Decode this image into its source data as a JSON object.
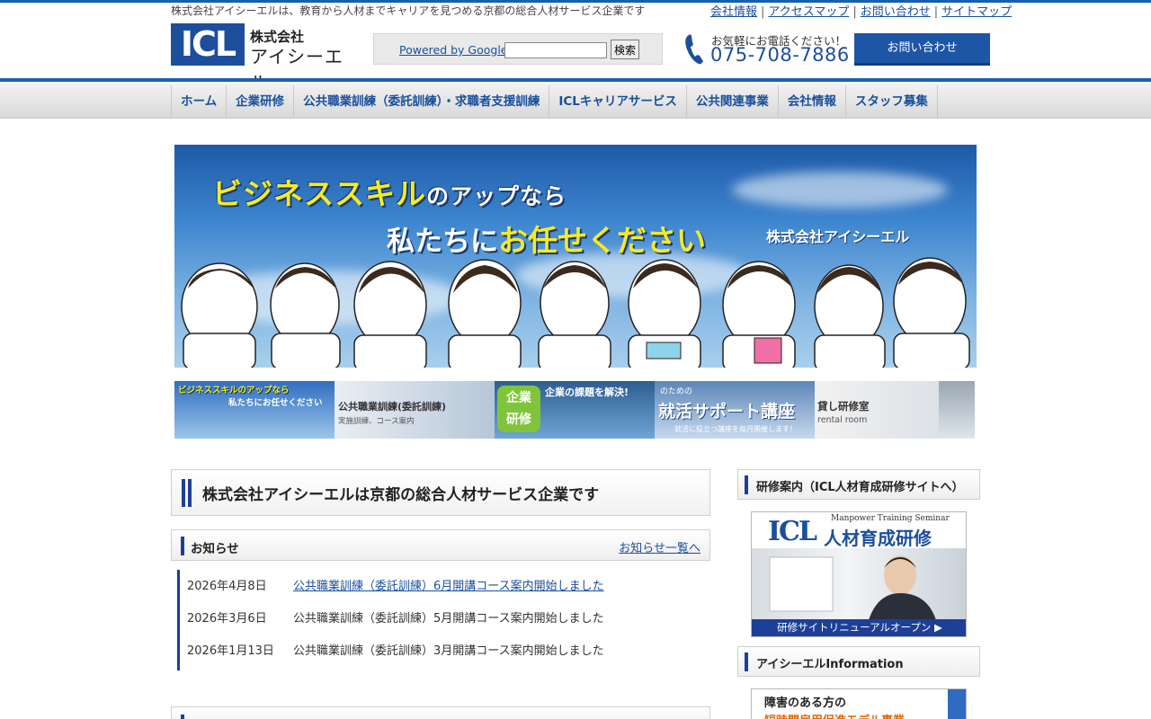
{
  "header": {
    "tagline": "株式会社アイシーエルは、教育から人材までキャリアを見つめる京都の総合人材サービス企業です",
    "top_links": [
      "会社情報",
      "アクセスマップ",
      "お問い合わせ",
      "サイトマップ"
    ],
    "logo": {
      "mark": "ICL",
      "line1": "株式会社",
      "line2": "アイシーエル"
    },
    "search": {
      "powered_by": "Powered by Google",
      "value": "",
      "button": "検索"
    },
    "phone": {
      "label": "お気軽にお電話ください！",
      "number": "075-708-7886"
    },
    "contact_button": "お問い合わせ"
  },
  "nav": [
    "ホーム",
    "企業研修",
    "公共職業訓練（委託訓練）・求職者支援訓練",
    "ICLキャリアサービス",
    "公共関連事業",
    "会社情報",
    "スタッフ募集"
  ],
  "hero": {
    "line1_a": "ビジネススキル",
    "line1_b": "のアップなら",
    "line2_a": "私たちに",
    "line2_b": "お任せください",
    "company": "株式会社アイシーエル"
  },
  "banners": {
    "b1_line1": "ビジネススキルのアップなら",
    "b1_line2": "私たちにお任せください",
    "b2_title": "公共職業訓練(委託訓練)",
    "b2_sub": "実施訓練、コース案内",
    "b3_badge_1": "企業",
    "b3_badge_2": "研修",
    "b3_title": "企業の課題を解決!",
    "b4_top": "のための",
    "b4_title": "就活サポート講座",
    "b4_sub": "就活に役立つ講座を毎月開催します！",
    "b5_title": "貸し研修室",
    "b5_sub": "rental room"
  },
  "main": {
    "title": "株式会社アイシーエルは京都の総合人材サービス企業です",
    "news_heading": "お知らせ",
    "news_more": "お知らせ一覧へ",
    "news": [
      {
        "date": "2026年4月8日",
        "text": "公共職業訓練（委託訓練）6月開講コース案内開始しました",
        "link": true
      },
      {
        "date": "2026年3月6日",
        "text": "公共職業訓練（委託訓練）5月開講コース案内開始しました",
        "link": false
      },
      {
        "date": "2026年1月13日",
        "text": "公共職業訓練（委託訓練）3月開講コース案内開始しました",
        "link": false
      }
    ]
  },
  "sidebar": {
    "training_heading": "研修案内（ICL人材育成研修サイトへ）",
    "training_banner": {
      "logo": "ICL",
      "subtitle": "Manpower Training Seminar",
      "title": "人材育成研修",
      "footer": "研修サイトリニューアルオープン ▶"
    },
    "info_heading": "アイシーエルInformation",
    "info_banner_line1": "障害のある方の",
    "info_banner_line2": "短時間雇用促進モデル事業"
  },
  "colors": {
    "brand_blue": "#1d4e9b",
    "nav_top": "#1b5eb0",
    "link": "#1a4f9c"
  }
}
